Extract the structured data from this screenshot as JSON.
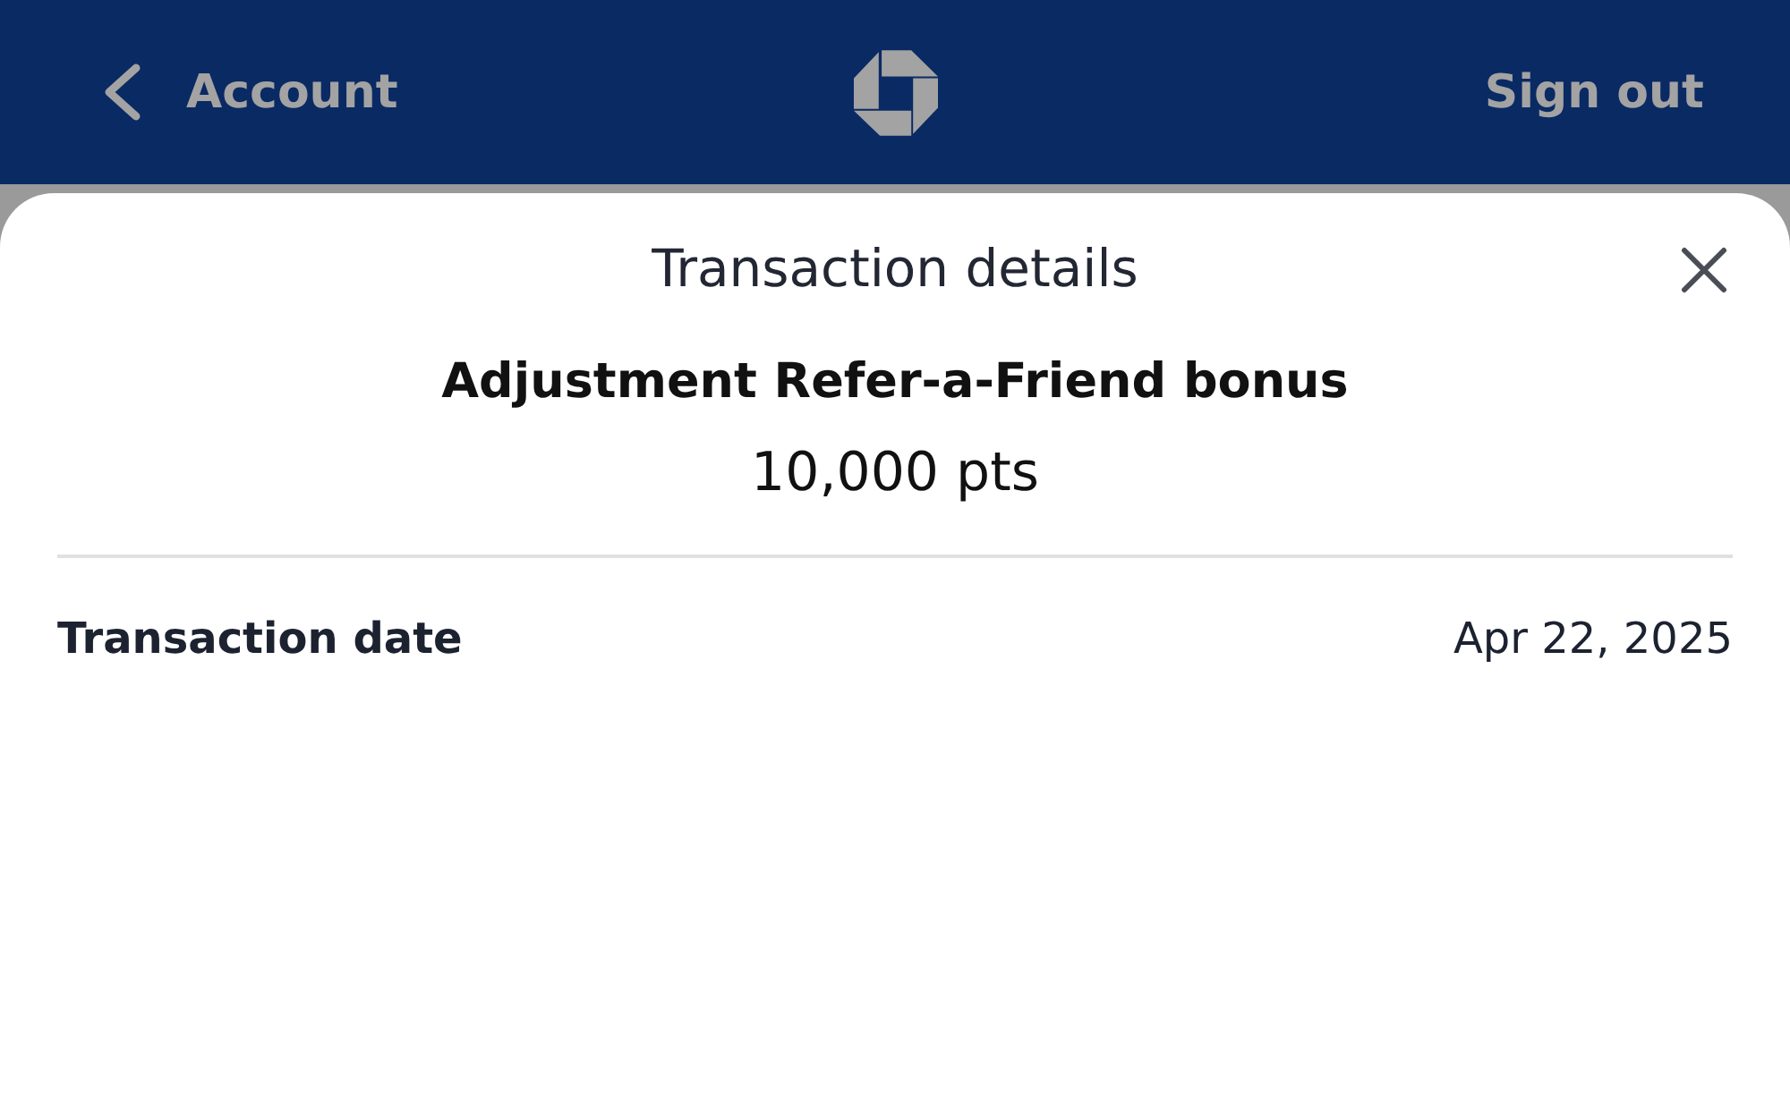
{
  "header": {
    "back_label": "Account",
    "sign_out_label": "Sign out"
  },
  "sheet": {
    "title": "Transaction details",
    "transaction": {
      "description": "Adjustment Refer-a-Friend bonus",
      "amount": "10,000 pts"
    },
    "details": [
      {
        "label": "Transaction date",
        "value": "Apr 22, 2025"
      }
    ]
  }
}
